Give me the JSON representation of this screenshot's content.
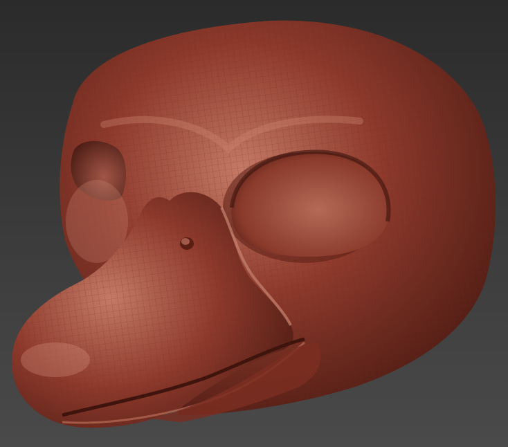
{
  "viewport": {
    "subject_icon": "duck-head-sculpt-icon",
    "colors": {
      "background_top": "#2b2b2b",
      "background_bottom": "#4a4a4a",
      "material_base": "#8e3a2c",
      "material_light": "#c47a66",
      "material_dark": "#4a1a12",
      "wire": "#6b2a1f"
    }
  }
}
